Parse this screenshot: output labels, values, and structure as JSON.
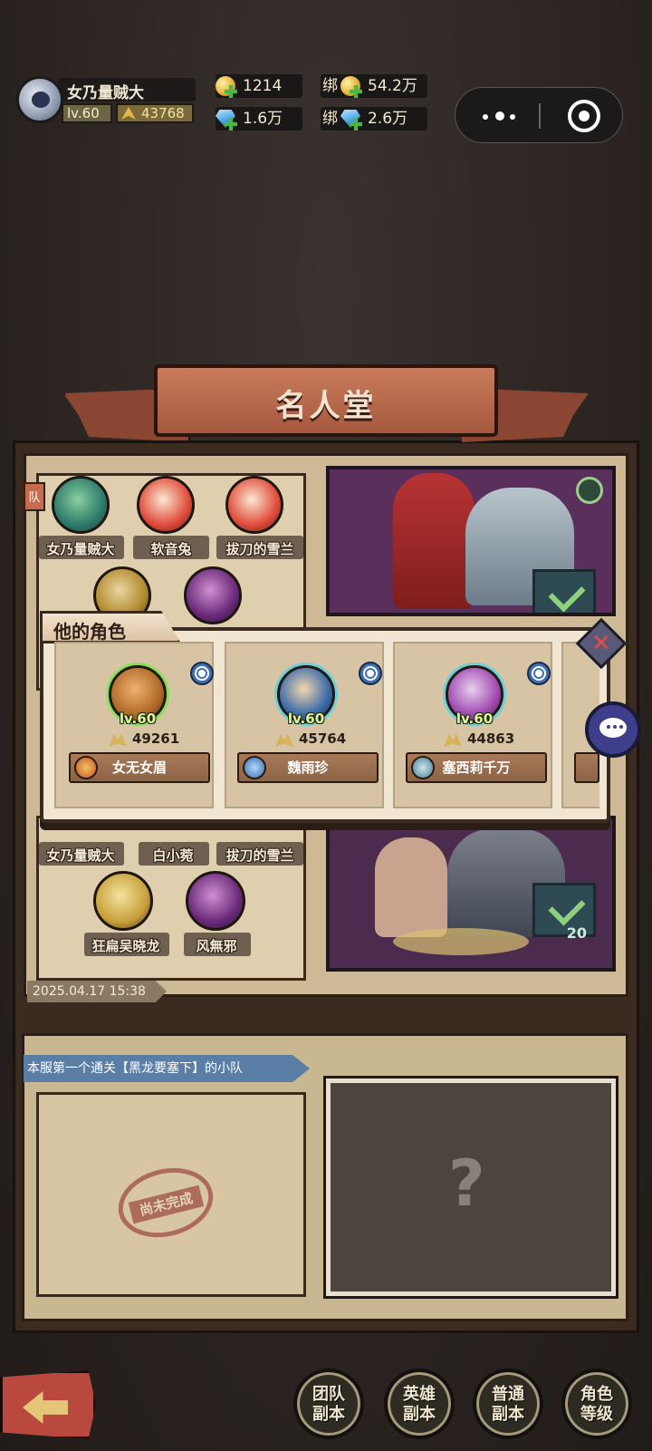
{
  "player": {
    "name": "女乃量贼大",
    "level": "lv.60",
    "power": "43768"
  },
  "currency": {
    "gold": "1214",
    "gems": "1.6万",
    "bound_prefix": "绑",
    "bound_gold": "54.2万",
    "bound_gems": "2.6万"
  },
  "hall": {
    "title": "名人堂"
  },
  "team1": {
    "tab": "队",
    "members": [
      "女乃量贼大",
      "软音兔",
      "拔刀的雪兰"
    ]
  },
  "team2": {
    "members": [
      "女乃量贼大",
      "白小菀",
      "拔刀的雪兰",
      "狂扁吴晓龙",
      "风無邪"
    ],
    "date": "2025.04.17 15:38",
    "badge_count": "20"
  },
  "section2": {
    "title": "本服第一个通关【黑龙要塞下】的小队",
    "stamp": "尚未完成",
    "unknown": "?"
  },
  "popup": {
    "title": "他的角色",
    "characters": [
      {
        "level": "lv.60",
        "power": "49261",
        "name": "女无女眉"
      },
      {
        "level": "lv.60",
        "power": "45764",
        "name": "魏雨珍"
      },
      {
        "level": "lv.60",
        "power": "44863",
        "name": "塞西莉千万"
      }
    ],
    "close": "✕"
  },
  "nav": [
    {
      "label": "团队副本"
    },
    {
      "label": "英雄副本"
    },
    {
      "label": "普通副本"
    },
    {
      "label": "角色等级"
    }
  ],
  "colors": {
    "accent": "#a6583f",
    "panel": "#cdb996",
    "popup": "#f1e6d2",
    "level": "#e4f39b"
  }
}
